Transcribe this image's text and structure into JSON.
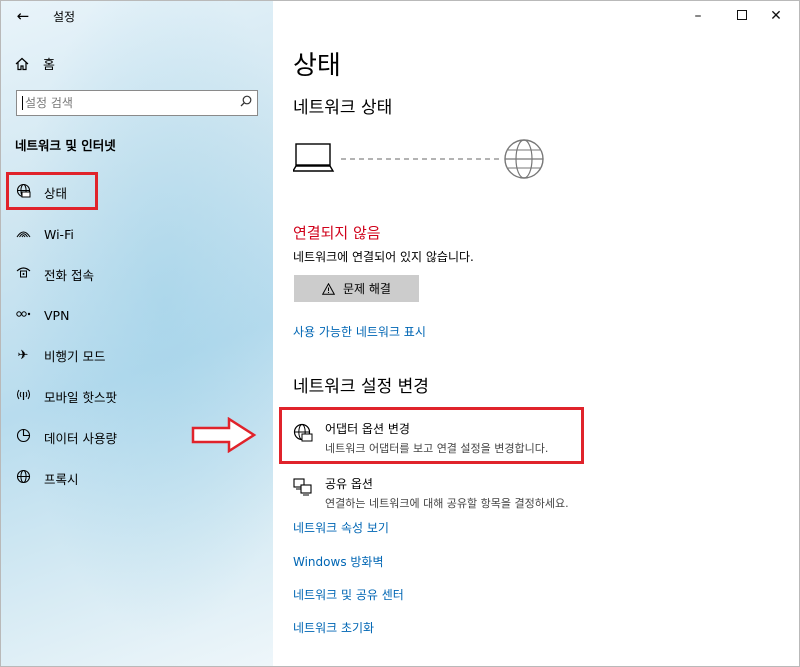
{
  "app": {
    "title": "설정",
    "back_icon": "back-arrow-icon",
    "window_controls": [
      "minimize-icon",
      "maximize-icon",
      "close-icon"
    ]
  },
  "sidebar": {
    "home_label": "홈",
    "search_placeholder": "설정 검색",
    "section_title": "네트워크 및 인터넷",
    "items": [
      {
        "label": "상태",
        "icon": "status-globe-icon"
      },
      {
        "label": "Wi-Fi",
        "icon": "wifi-icon"
      },
      {
        "label": "전화 접속",
        "icon": "dial-up-icon"
      },
      {
        "label": "VPN",
        "icon": "vpn-icon"
      },
      {
        "label": "비행기 모드",
        "icon": "airplane-icon"
      },
      {
        "label": "모바일 핫스팟",
        "icon": "hotspot-icon"
      },
      {
        "label": "데이터 사용량",
        "icon": "data-usage-icon"
      },
      {
        "label": "프록시",
        "icon": "globe-icon"
      }
    ]
  },
  "main": {
    "title": "상태",
    "network_status_heading": "네트워크 상태",
    "status_title": "연결되지 않음",
    "status_desc": "네트워크에 연결되어 있지 않습니다.",
    "troubleshoot_label": "문제 해결",
    "show_networks_link": "사용 가능한 네트워크 표시",
    "change_settings_heading": "네트워크 설정 변경",
    "options": [
      {
        "title": "어댑터 옵션 변경",
        "desc": "네트워크 어댑터를 보고 연결 설정을 변경합니다.",
        "icon": "adapter-globe-icon"
      },
      {
        "title": "공유 옵션",
        "desc": "연결하는 네트워크에 대해 공유할 항목을 결정하세요.",
        "icon": "sharing-icon"
      }
    ],
    "links": [
      "네트워크 속성 보기",
      "Windows 방화벽",
      "네트워크 및 공유 센터",
      "네트워크 초기화"
    ]
  },
  "colors": {
    "accent_link": "#0066b4",
    "error": "#d0021b",
    "highlight": "#e0232b"
  }
}
